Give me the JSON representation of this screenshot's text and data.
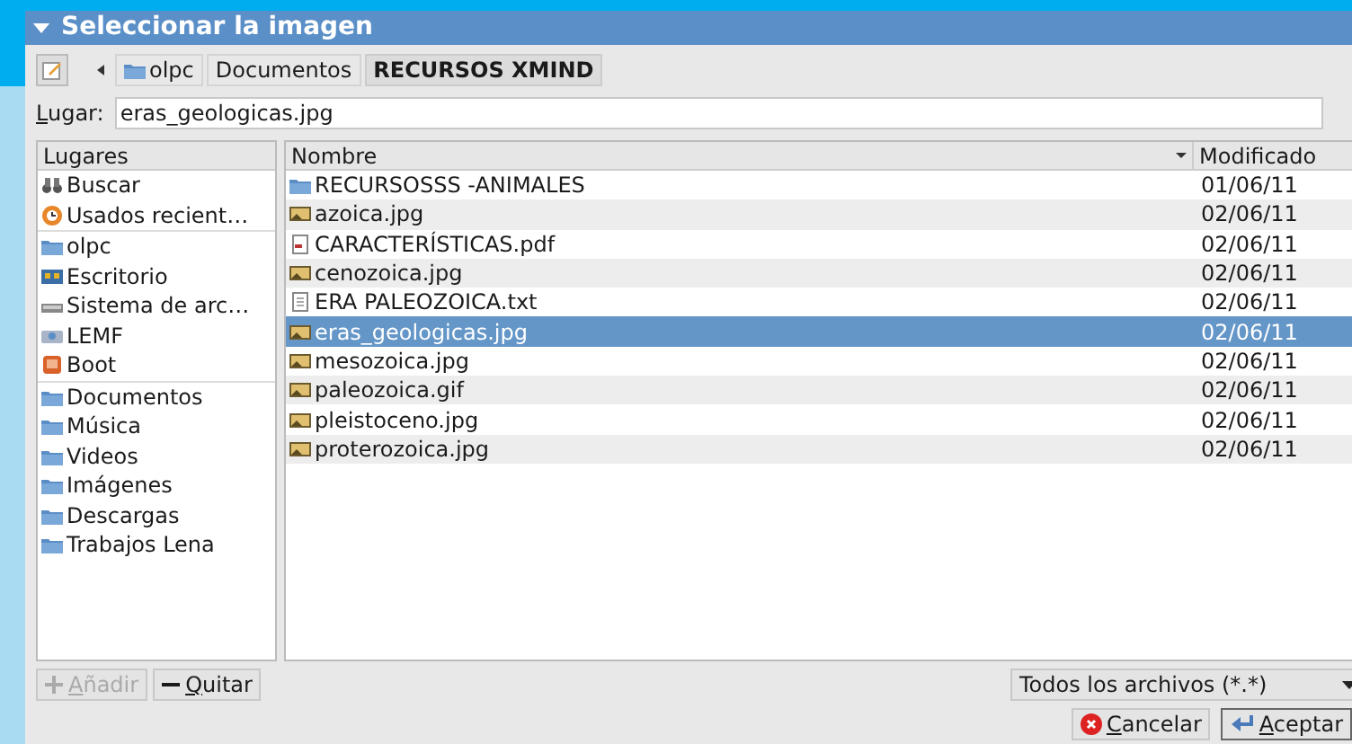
{
  "window": {
    "title": "Seleccionar la imagen"
  },
  "path_bar": {
    "buttons": [
      {
        "label": "olpc",
        "kind": "home",
        "selected": false
      },
      {
        "label": "Documentos",
        "kind": "plain",
        "selected": false
      },
      {
        "label": "RECURSOS XMIND",
        "kind": "plain",
        "selected": true
      }
    ]
  },
  "location": {
    "label": "Lugar:",
    "value": "eras_geologicas.jpg"
  },
  "places": {
    "header": "Lugares",
    "groups": [
      [
        {
          "label": "Buscar",
          "kind": "search"
        },
        {
          "label": "Usados recient…",
          "kind": "recent"
        }
      ],
      [
        {
          "label": "olpc",
          "kind": "home"
        },
        {
          "label": "Escritorio",
          "kind": "desktop"
        },
        {
          "label": "Sistema de arc…",
          "kind": "drive"
        },
        {
          "label": "LEMF",
          "kind": "usb"
        },
        {
          "label": "Boot",
          "kind": "boot"
        }
      ],
      [
        {
          "label": "Documentos",
          "kind": "folder"
        },
        {
          "label": "Música",
          "kind": "folder"
        },
        {
          "label": "Videos",
          "kind": "folder"
        },
        {
          "label": "Imágenes",
          "kind": "folder"
        },
        {
          "label": "Descargas",
          "kind": "folder"
        },
        {
          "label": "Trabajos Lena",
          "kind": "folder"
        }
      ]
    ]
  },
  "files": {
    "columns": [
      "Nombre",
      "Modificado"
    ],
    "rows": [
      {
        "name": "RECURSOSSS -ANIMALES",
        "kind": "folder",
        "modified": "01/06/11",
        "selected": false
      },
      {
        "name": "azoica.jpg",
        "kind": "image",
        "modified": "02/06/11",
        "selected": false
      },
      {
        "name": "CARACTERÍSTICAS.pdf",
        "kind": "pdf",
        "modified": "02/06/11",
        "selected": false
      },
      {
        "name": "cenozoica.jpg",
        "kind": "image",
        "modified": "02/06/11",
        "selected": false
      },
      {
        "name": "ERA PALEOZOICA.txt",
        "kind": "text",
        "modified": "02/06/11",
        "selected": false
      },
      {
        "name": "eras_geologicas.jpg",
        "kind": "image",
        "modified": "02/06/11",
        "selected": true
      },
      {
        "name": "mesozoica.jpg",
        "kind": "image",
        "modified": "02/06/11",
        "selected": false
      },
      {
        "name": "paleozoica.gif",
        "kind": "image",
        "modified": "02/06/11",
        "selected": false
      },
      {
        "name": "pleistoceno.jpg",
        "kind": "image",
        "modified": "02/06/11",
        "selected": false
      },
      {
        "name": "proterozoica.jpg",
        "kind": "image",
        "modified": "02/06/11",
        "selected": false
      }
    ]
  },
  "places_buttons": [
    {
      "label": "Añadir",
      "kind": "add",
      "disabled": true
    },
    {
      "label": "Quitar",
      "kind": "remove",
      "disabled": false
    }
  ],
  "filter": {
    "value": "Todos los archivos (*.*)"
  },
  "actions": [
    {
      "label": "Cancelar",
      "kind": "cancel"
    },
    {
      "label": "Aceptar",
      "kind": "ok"
    }
  ]
}
